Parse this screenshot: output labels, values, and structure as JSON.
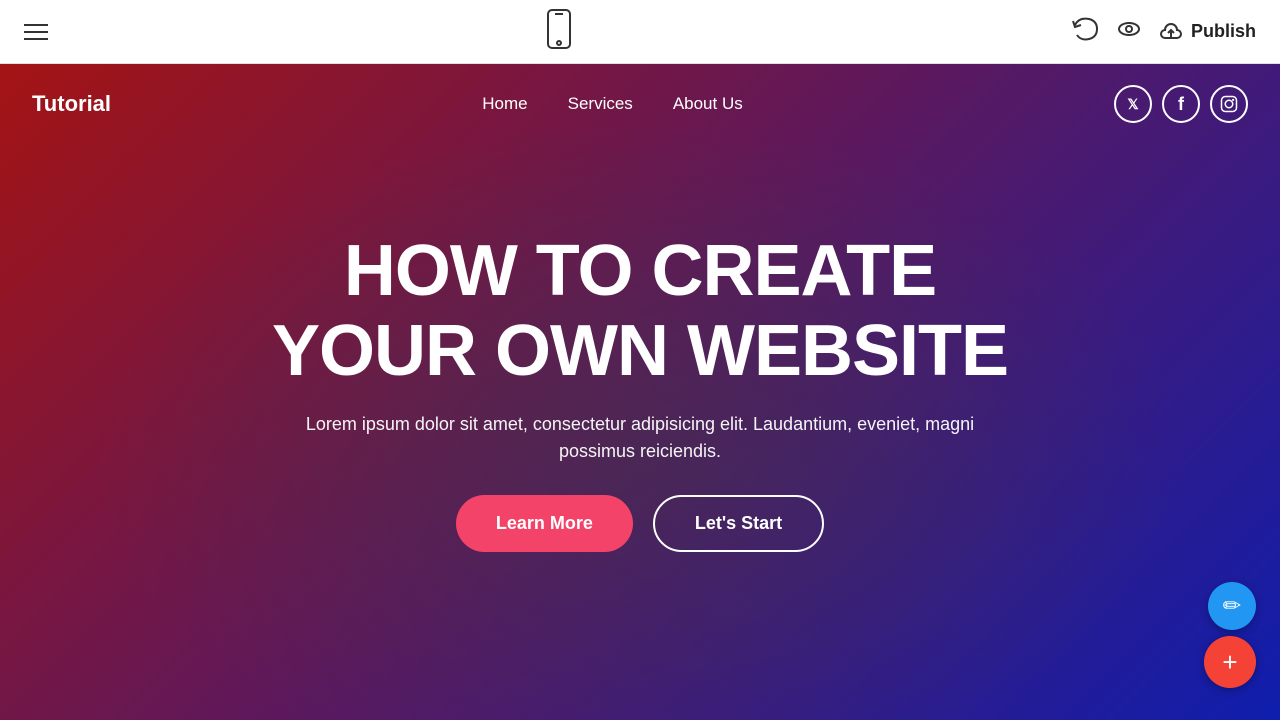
{
  "toolbar": {
    "hamburger_label": "menu",
    "phone_preview_label": "mobile preview",
    "undo_label": "undo",
    "eye_label": "preview",
    "cloud_label": "publish",
    "publish_label": "Publish"
  },
  "website": {
    "logo": "Tutorial",
    "nav": {
      "links": [
        {
          "label": "Home",
          "id": "home"
        },
        {
          "label": "Services",
          "id": "services"
        },
        {
          "label": "About Us",
          "id": "about-us"
        }
      ],
      "social": [
        {
          "label": "Twitter",
          "icon": "𝕏",
          "id": "twitter"
        },
        {
          "label": "Facebook",
          "icon": "f",
          "id": "facebook"
        },
        {
          "label": "Instagram",
          "icon": "📷",
          "id": "instagram"
        }
      ]
    },
    "hero": {
      "title_line1": "HOW TO CREATE",
      "title_line2": "YOUR OWN WEBSITE",
      "subtitle": "Lorem ipsum dolor sit amet, consectetur adipisicing elit. Laudantium, eveniet, magni possimus reiciendis.",
      "btn_learn_more": "Learn More",
      "btn_lets_start": "Let's Start"
    }
  },
  "fabs": {
    "edit_label": "edit",
    "add_label": "add"
  }
}
